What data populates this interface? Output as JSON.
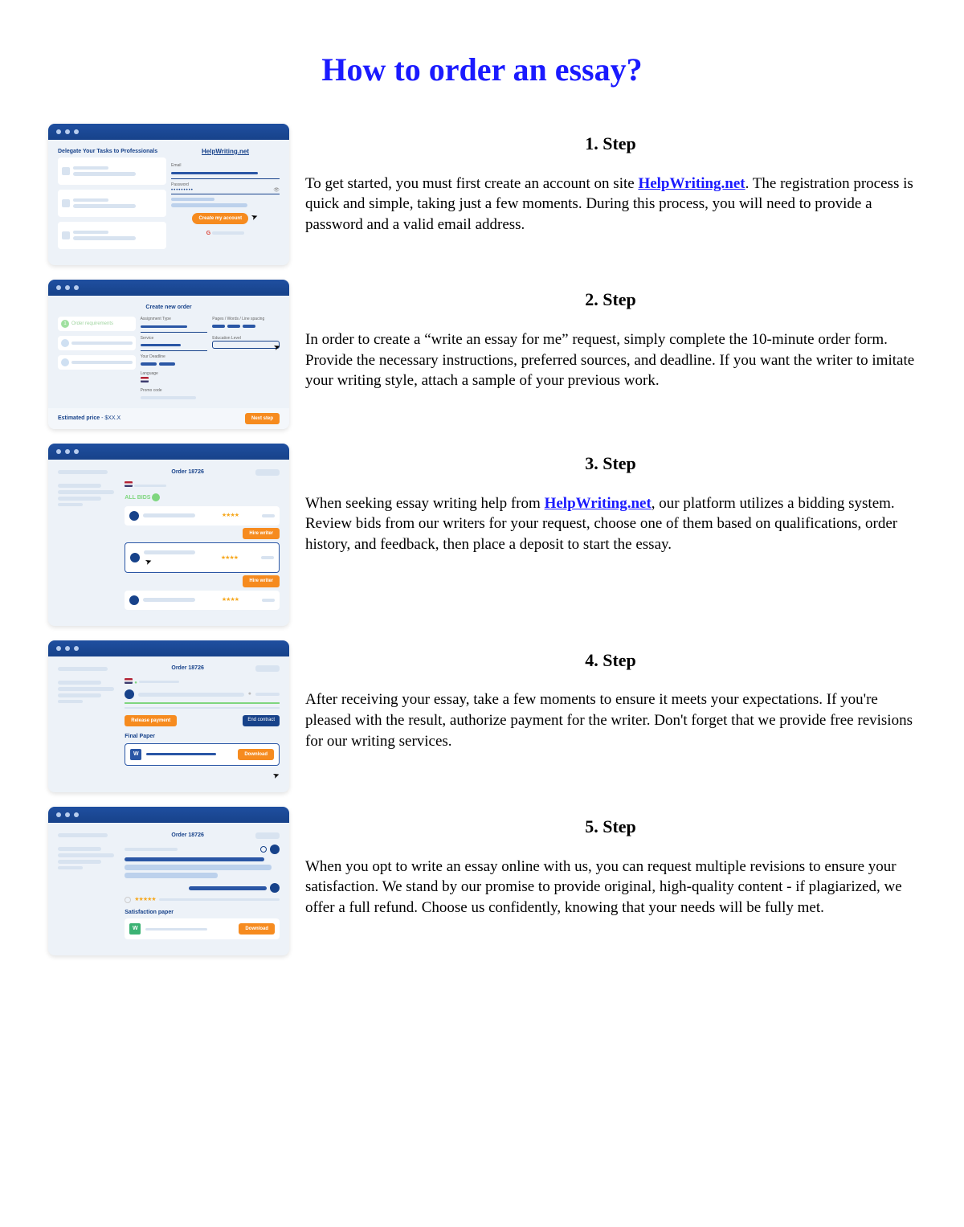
{
  "title": "How to order an essay?",
  "link_text": "HelpWriting.net",
  "steps": [
    {
      "heading": "1. Step",
      "body_pre": "To get started, you must first create an account on site ",
      "body_link": "HelpWriting.net",
      "body_post": ". The registration process is quick and simple, taking just a few moments. During this process, you will need to provide a password and a valid email address."
    },
    {
      "heading": "2. Step",
      "body_pre": "In order to create a “write an essay for me” request, simply complete the 10-minute order form. Provide the necessary instructions, preferred sources, and deadline. If you want the writer to imitate your writing style, attach a sample of your previous work.",
      "body_link": "",
      "body_post": ""
    },
    {
      "heading": "3. Step",
      "body_pre": "When seeking essay writing help from ",
      "body_link": "HelpWriting.net",
      "body_post": ", our platform utilizes a bidding system. Review bids from our writers for your request, choose one of them based on qualifications, order history, and feedback, then place a deposit to start the essay."
    },
    {
      "heading": "4. Step",
      "body_pre": "After receiving your essay, take a few moments to ensure it meets your expectations. If you're pleased with the result, authorize payment for the writer. Don't forget that we provide free revisions for our writing services.",
      "body_link": "",
      "body_post": ""
    },
    {
      "heading": "5. Step",
      "body_pre": "When you opt to write an essay online with us, you can request multiple revisions to ensure your satisfaction. We stand by our promise to provide original, high-quality content - if plagiarized, we offer a full refund. Choose us confidently, knowing that your needs will be fully met.",
      "body_link": "",
      "body_post": ""
    }
  ],
  "mock": {
    "s1": {
      "tagline": "Delegate Your Tasks to Professionals",
      "brand": "HelpWriting.net",
      "email_label": "Email",
      "password_label": "Password",
      "create_btn": "Create my account"
    },
    "s2": {
      "title": "Create new order",
      "side1": "Order requirements",
      "f_assignment": "Assignment Type",
      "f_pages": "Pages / Words / Line spacing",
      "f_service": "Service",
      "f_edu": "Education Level",
      "f_deadline": "Your Deadline",
      "f_lang": "Language",
      "f_promo": "Promo code",
      "price_label": "Estimated price",
      "price_value": "$XX.X",
      "next_btn": "Next step"
    },
    "s3": {
      "title": "Order 18726",
      "filter": "ALL BIDS",
      "hire_btn": "Hire writer"
    },
    "s4": {
      "title": "Order 18726",
      "release_btn": "Release payment",
      "end_btn": "End contract",
      "final_label": "Final Paper",
      "download_btn": "Download"
    },
    "s5": {
      "title": "Order 18726",
      "sat_label": "Satisfaction paper",
      "download_btn": "Download"
    }
  }
}
